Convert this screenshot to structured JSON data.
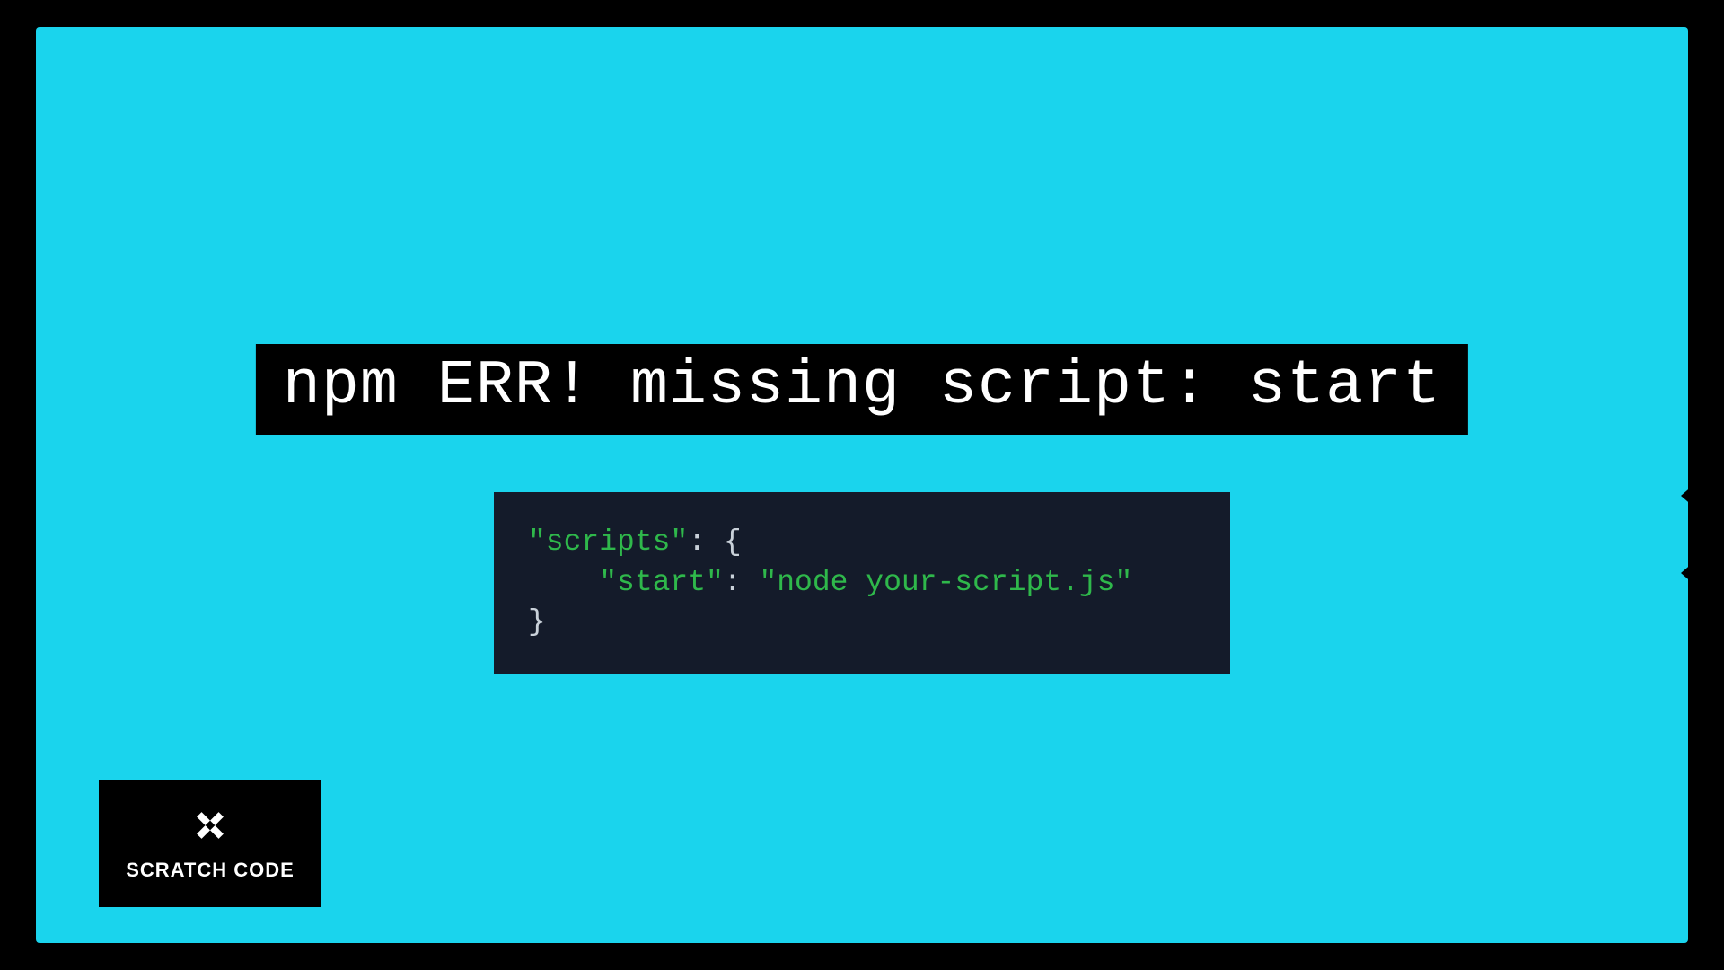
{
  "error_message": "npm ERR! missing script: start",
  "code": {
    "line1_key": "\"scripts\"",
    "line1_after": ": {",
    "line2_indent": "    ",
    "line2_key": "\"start\"",
    "line2_colon": ": ",
    "line2_value": "\"node your-script.js\"",
    "line3": "}"
  },
  "brand": {
    "label": "SCRATCH CODE",
    "icon_name": "angle-brackets-icon"
  }
}
